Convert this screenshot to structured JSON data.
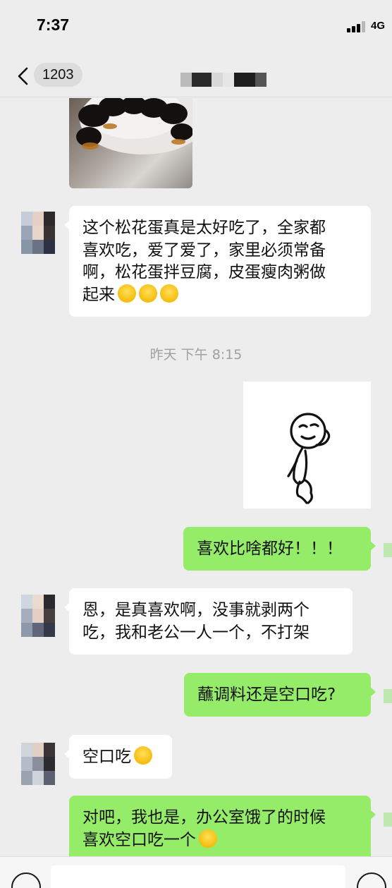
{
  "status_bar": {
    "time": "7:37",
    "network": "4G"
  },
  "nav": {
    "back_icon": "chevron-left-icon",
    "unread_count": "1203"
  },
  "timestamp": "昨天 下午 8:15",
  "messages": [
    {
      "side": "left",
      "type": "text",
      "text": "这个松花蛋真是太好吃了，全家都\n喜欢吃，爱了爱了，家里必须常备\n啊，松花蛋拌豆腐，皮蛋瘦肉粥做\n起来",
      "emoji": "heart-eyes-emoji"
    },
    {
      "side": "right",
      "type": "text",
      "text": "喜欢比啥都好！！！"
    },
    {
      "side": "left",
      "type": "text",
      "text": "恩，是真喜欢啊，没事就剥两个\n吃，我和老公一人一个，不打架"
    },
    {
      "side": "right",
      "type": "text",
      "text": "蘸调料还是空口吃?"
    },
    {
      "side": "left",
      "type": "text",
      "text": "空口吃",
      "emoji": "laughing-tears-emoji"
    },
    {
      "side": "right",
      "type": "text",
      "text": "对吧，我也是，办公室饿了的时候\n喜欢空口吃一个",
      "emoji": "thinking-emoji"
    }
  ],
  "colors": {
    "background": "#ededed",
    "bubble_left": "#ffffff",
    "bubble_right": "#95ec69",
    "timestamp": "#a0a0a0"
  },
  "input_bar": {
    "voice_icon": "voice-icon",
    "emoji_icon": "emoji-icon"
  }
}
